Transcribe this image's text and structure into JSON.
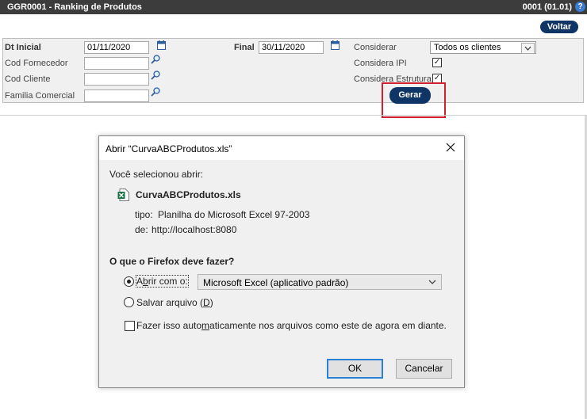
{
  "titlebar": {
    "title": "GGR0001 - Ranking de Produtos",
    "version": "0001 (01.01)",
    "help": "?"
  },
  "voltar_label": "Voltar",
  "filters": {
    "dt_inicial_label": "Dt Inicial",
    "dt_inicial_value": "01/11/2020",
    "final_label": "Final",
    "final_value": "30/11/2020",
    "cod_fornecedor_label": "Cod Fornecedor",
    "cod_cliente_label": "Cod Cliente",
    "familia_label": "Familia Comercial",
    "considerar_label": "Considerar",
    "considerar_value": "Todos os clientes",
    "considera_ipi_label": "Considera IPI",
    "considera_estrutura_label": "Considera Estrutura",
    "check_mark": "✓"
  },
  "gerar_label": "Gerar",
  "dialog": {
    "title": "Abrir “CurvaABCProdutos.xls”",
    "selected_text": "Você selecionou abrir:",
    "filename": "CurvaABCProdutos.xls",
    "tipo_label": "tipo:",
    "tipo_value": "Planilha do Microsoft Excel 97-2003",
    "de_label": "de:",
    "de_value": "http://localhost:8080",
    "question": "O que o Firefox deve fazer?",
    "open_with_pre": "A",
    "open_with_u": "b",
    "open_with_post": "rir com o:",
    "open_with_app": "Microsoft Excel (aplicativo padrão)",
    "save_pre": "Salvar arquivo (",
    "save_u": "D",
    "save_post": ")",
    "auto_pre": "Fazer isso auto",
    "auto_u": "m",
    "auto_post": "aticamente nos arquivos como este de agora em diante.",
    "ok_label": "OK",
    "cancel_label": "Cancelar"
  },
  "colors": {
    "titlebar": "#3c3c3c",
    "pill": "#0f3466",
    "highlight": "#d2202e",
    "focus": "#2a7fd6"
  }
}
